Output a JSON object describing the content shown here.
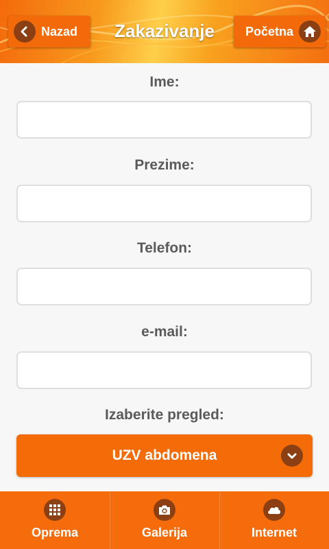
{
  "header": {
    "title": "Zakazivanje",
    "back_label": "Nazad",
    "home_label": "Početna"
  },
  "form": {
    "first_name_label": "Ime:",
    "last_name_label": "Prezime:",
    "phone_label": "Telefon:",
    "email_label": "e-mail:",
    "exam_label": "Izaberite pregled:",
    "first_name_value": "",
    "last_name_value": "",
    "phone_value": "",
    "email_value": "",
    "exam_selected": "UZV abdomena"
  },
  "nav": {
    "items": [
      {
        "label": "Oprema",
        "icon": "grid-icon"
      },
      {
        "label": "Galerija",
        "icon": "camera-icon"
      },
      {
        "label": "Internet",
        "icon": "cloud-icon"
      }
    ]
  },
  "colors": {
    "accent": "#f36c08",
    "icon_circle": "#8b3f12",
    "label_text": "#5a5a5a",
    "background": "#f7f7f7"
  }
}
